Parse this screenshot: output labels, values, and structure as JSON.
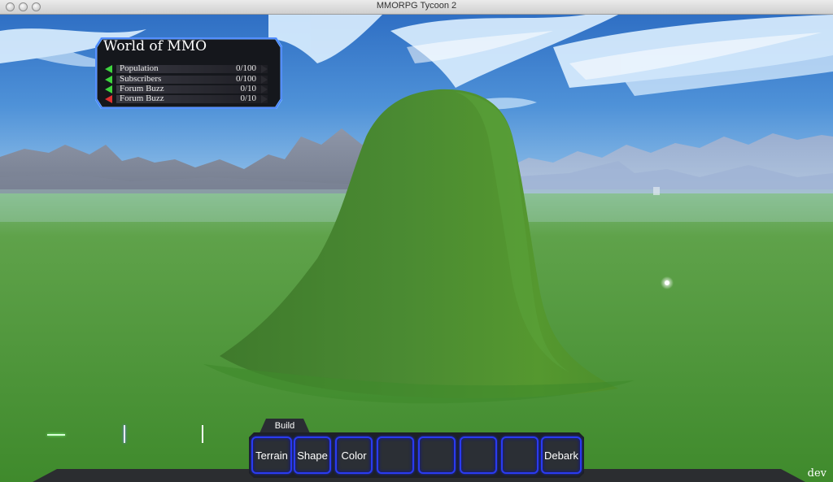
{
  "window": {
    "title": "MMORPG Tycoon 2"
  },
  "stats_panel": {
    "title": "World of MMO",
    "rows": [
      {
        "label": "Population",
        "value": "0/100",
        "trend": "up"
      },
      {
        "label": "Subscribers",
        "value": "0/100",
        "trend": "up"
      },
      {
        "label": "Forum Buzz",
        "value": "0/10",
        "trend": "up"
      },
      {
        "label": "Forum Buzz",
        "value": "0/10",
        "trend": "down"
      }
    ]
  },
  "build_toolbar": {
    "tab_label": "Build",
    "slots": [
      {
        "label": "Terrain"
      },
      {
        "label": "Shape"
      },
      {
        "label": "Color"
      },
      {
        "label": ""
      },
      {
        "label": ""
      },
      {
        "label": ""
      },
      {
        "label": ""
      },
      {
        "label": "Debark"
      }
    ]
  },
  "hud": {
    "mode_label": "dev"
  },
  "colors": {
    "slot_border": "#2a3bf0",
    "trend_up": "#3ed43e",
    "trend_down": "#e03030",
    "panel_glow": "#4a8cff"
  }
}
